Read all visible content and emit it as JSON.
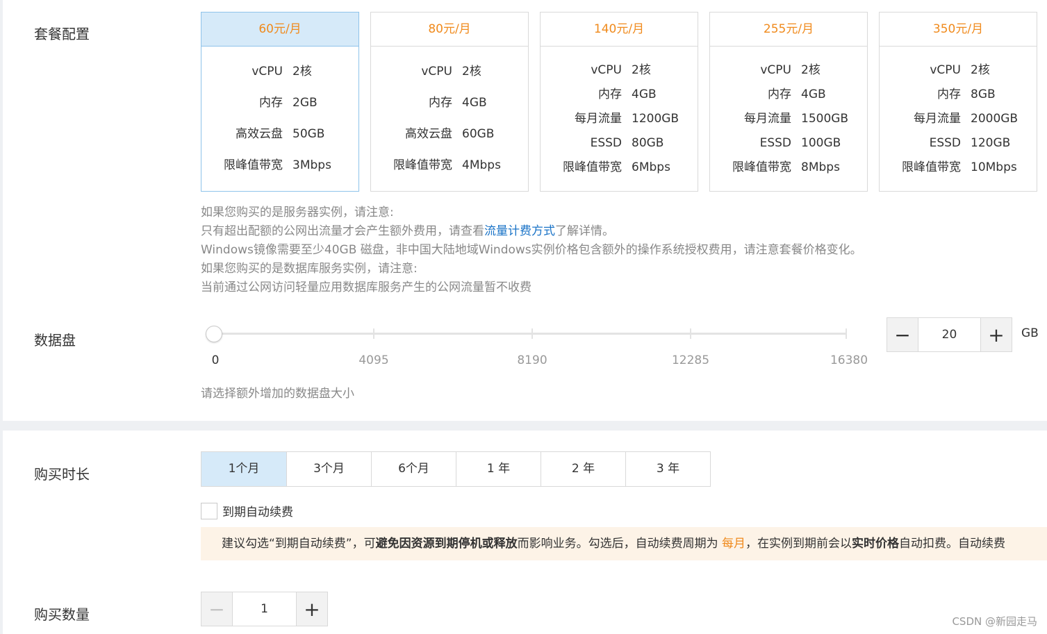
{
  "package": {
    "label": "套餐配置",
    "plans": [
      {
        "price": "60元/月",
        "selected": true,
        "specs": [
          {
            "k": "vCPU",
            "v": "2核"
          },
          {
            "k": "内存",
            "v": "2GB"
          },
          {
            "k": "高效云盘",
            "v": "50GB"
          },
          {
            "k": "限峰值带宽",
            "v": "3Mbps"
          }
        ]
      },
      {
        "price": "80元/月",
        "selected": false,
        "specs": [
          {
            "k": "vCPU",
            "v": "2核"
          },
          {
            "k": "内存",
            "v": "4GB"
          },
          {
            "k": "高效云盘",
            "v": "60GB"
          },
          {
            "k": "限峰值带宽",
            "v": "4Mbps"
          }
        ]
      },
      {
        "price": "140元/月",
        "selected": false,
        "specs": [
          {
            "k": "vCPU",
            "v": "2核"
          },
          {
            "k": "内存",
            "v": "4GB"
          },
          {
            "k": "每月流量",
            "v": "1200GB"
          },
          {
            "k": "ESSD",
            "v": "80GB"
          },
          {
            "k": "限峰值带宽",
            "v": "6Mbps"
          }
        ]
      },
      {
        "price": "255元/月",
        "selected": false,
        "specs": [
          {
            "k": "vCPU",
            "v": "2核"
          },
          {
            "k": "内存",
            "v": "4GB"
          },
          {
            "k": "每月流量",
            "v": "1500GB"
          },
          {
            "k": "ESSD",
            "v": "100GB"
          },
          {
            "k": "限峰值带宽",
            "v": "8Mbps"
          }
        ]
      },
      {
        "price": "350元/月",
        "selected": false,
        "specs": [
          {
            "k": "vCPU",
            "v": "2核"
          },
          {
            "k": "内存",
            "v": "8GB"
          },
          {
            "k": "每月流量",
            "v": "2000GB"
          },
          {
            "k": "ESSD",
            "v": "120GB"
          },
          {
            "k": "限峰值带宽",
            "v": "10Mbps"
          }
        ]
      }
    ],
    "notes": {
      "line1": "如果您购买的是服务器实例，请注意:",
      "line2_before": "只有超出配额的公网出流量才会产生额外费用，请查看",
      "line2_link": "流量计费方式",
      "line2_after": "了解详情。",
      "line3": "Windows镜像需要至少40GB 磁盘，非中国大陆地域Windows实例价格包含额外的操作系统授权费用，请注意套餐价格变化。",
      "line4": "如果您购买的是数据库服务实例，请注意:",
      "line5": "当前通过公网访问轻量应用数据库服务产生的公网流量暂不收费"
    }
  },
  "data_disk": {
    "label": "数据盘",
    "slider_ticks": [
      "0",
      "4095",
      "8190",
      "12285",
      "16380"
    ],
    "slider_value_fraction": 0.0,
    "stepper": {
      "minus": "−",
      "value": "20",
      "plus": "+"
    },
    "unit": "GB",
    "hint": "请选择额外增加的数据盘大小"
  },
  "duration": {
    "label": "购买时长",
    "options": [
      "1个月",
      "3个月",
      "6个月",
      "1 年",
      "2 年",
      "3 年"
    ],
    "selected_index": 0,
    "auto_renew_label": "到期自动续费",
    "auto_renew_checked": false,
    "tip": {
      "p1": "建议勾选“到期自动续费”，可",
      "b1": "避免因资源到期停机或释放",
      "p2": "而影响业务。勾选后，自动续费周期为 ",
      "o1": "每月",
      "p3": "，在实例到期前会以",
      "b2": "实时价格",
      "p4": "自动扣费。自动续费"
    }
  },
  "quantity": {
    "label": "购买数量",
    "stepper": {
      "minus": "−",
      "value": "1",
      "plus": "+"
    }
  },
  "watermark": "CSDN @新园走马",
  "colors": {
    "accent_orange": "#f08a1c",
    "selected_bg": "#d6eaf9",
    "link_blue": "#1a73c7",
    "tip_bg": "#fdf3e7"
  }
}
